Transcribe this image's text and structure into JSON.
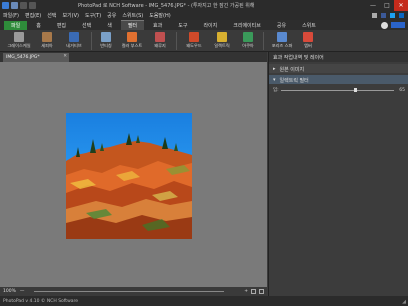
{
  "app": {
    "title": "PhotoPad 로 NCH Software - IMG_5476.JPG* - (투자지고 한 잠긴 가공된 위해",
    "window_controls": [
      "—",
      "□",
      "✕"
    ]
  },
  "menubar": {
    "items": [
      "파일(F)",
      "편집(E)",
      "선택",
      "보기(V)",
      "도구(T)",
      "공유",
      "스위트(S)",
      "도움말(H)"
    ]
  },
  "tabs": {
    "items": [
      {
        "label": "파일",
        "style": "green"
      },
      {
        "label": "홈",
        "style": ""
      },
      {
        "label": "편집",
        "style": ""
      },
      {
        "label": "선택",
        "style": ""
      },
      {
        "label": "색",
        "style": ""
      },
      {
        "label": "필터",
        "style": "active"
      },
      {
        "label": "효과",
        "style": ""
      },
      {
        "label": "도구",
        "style": ""
      },
      {
        "label": "라이지",
        "style": ""
      },
      {
        "label": "크리에이티브",
        "style": ""
      },
      {
        "label": "공유",
        "style": ""
      },
      {
        "label": "스위트",
        "style": ""
      }
    ]
  },
  "ribbon": {
    "buttons": [
      {
        "label": "그레이스케일",
        "icon": "grayscale-icon",
        "color": "#9a9a9a"
      },
      {
        "label": "세피아",
        "icon": "sepia-icon",
        "color": "#a8794a"
      },
      {
        "label": "네거티브",
        "icon": "negative-icon",
        "color": "#3a6bb5"
      },
      {
        "label": "반티칭",
        "icon": "posterize-icon",
        "color": "#7aa0c8"
      },
      {
        "label": "컬러 부스트",
        "icon": "color-boost-icon",
        "color": "#e07030"
      },
      {
        "label": "왜루지",
        "icon": "oil-icon",
        "color": "#c05050"
      },
      {
        "label": "왜도우드",
        "icon": "shadow-icon",
        "color": "#d04a2a"
      },
      {
        "label": "일렉트릭",
        "icon": "electric-icon",
        "color": "#d8b030"
      },
      {
        "label": "아쿠아",
        "icon": "aqua-icon",
        "color": "#3a9a5a"
      },
      {
        "label": "포리즈 스파",
        "icon": "freeze-icon",
        "color": "#5a8ad0"
      },
      {
        "label": "엠버",
        "icon": "ember-icon",
        "color": "#d84a3a"
      }
    ]
  },
  "document": {
    "tab_label": "IMG_5476.JPG*"
  },
  "panel": {
    "header": "효과 작업내역 및 레이어",
    "sections": [
      {
        "label": "원본 이미지",
        "expanded": false
      },
      {
        "label": "일렉트릭 필터",
        "expanded": true
      }
    ],
    "controls": [
      {
        "label": "임:",
        "value": 65,
        "max": 100
      }
    ]
  },
  "statusbar": {
    "zoom": "100%",
    "zoom_minus": "—",
    "zoom_plus": "+",
    "footer": "PhotoPad v 4.10 © NCH Software"
  },
  "colors": {
    "accent_green": "#2e8b3a",
    "sky_blue": "#2a9ef0",
    "rock_orange": "#d2622a"
  }
}
